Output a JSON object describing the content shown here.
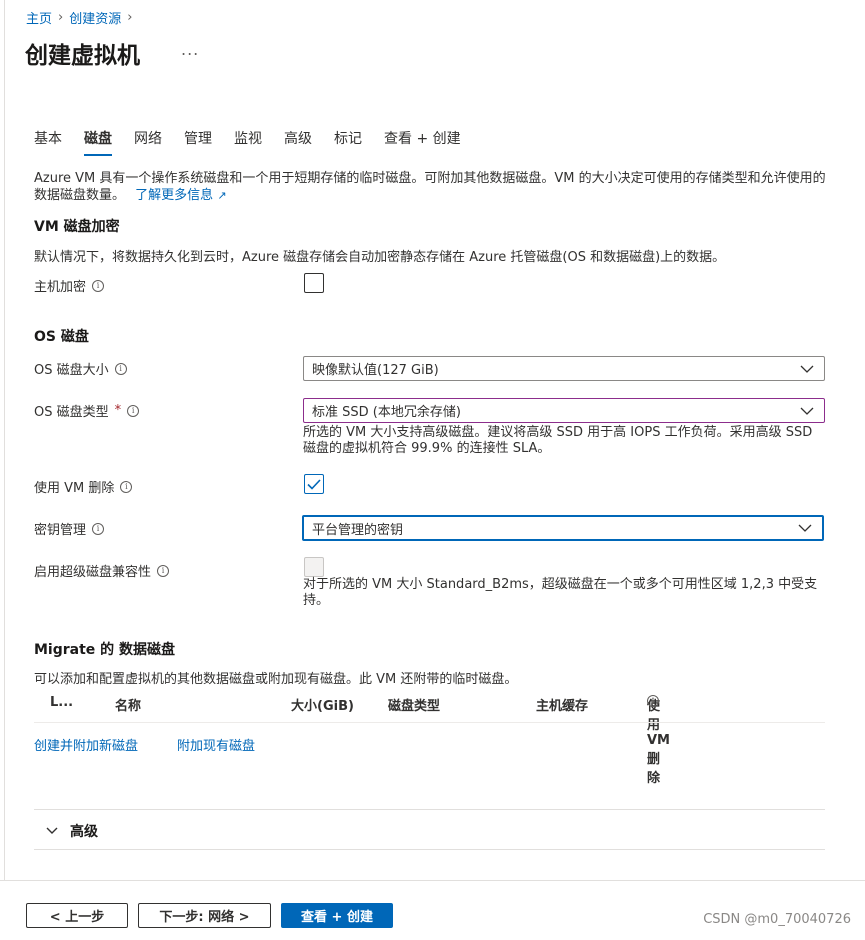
{
  "breadcrumb": {
    "home": "主页",
    "create_resource": "创建资源"
  },
  "page": {
    "title": "创建虚拟机",
    "more": "..."
  },
  "tabs": [
    {
      "label": "基本"
    },
    {
      "label": "磁盘",
      "active": true
    },
    {
      "label": "网络"
    },
    {
      "label": "管理"
    },
    {
      "label": "监视"
    },
    {
      "label": "高级"
    },
    {
      "label": "标记"
    },
    {
      "label": "查看 + 创建"
    }
  ],
  "intro": {
    "text": "Azure VM 具有一个操作系统磁盘和一个用于短期存储的临时磁盘。可附加其他数据磁盘。VM 的大小决定可使用的存储类型和允许使用的数据磁盘数量。",
    "learn_more": "了解更多信息"
  },
  "encryption": {
    "heading": "VM 磁盘加密",
    "description": "默认情况下，将数据持久化到云时，Azure 磁盘存储会自动加密静态存储在 Azure 托管磁盘(OS 和数据磁盘)上的数据。",
    "host_encryption_label": "主机加密",
    "host_encryption_checked": false
  },
  "os_disk": {
    "heading": "OS 磁盘",
    "size_label": "OS 磁盘大小",
    "size_value": "映像默认值(127 GiB)",
    "type_label": "OS 磁盘类型",
    "type_required": "*",
    "type_value": "标准 SSD (本地冗余存储)",
    "type_helper": "所选的 VM 大小支持高级磁盘。建议将高级 SSD 用于高 IOPS 工作负荷。采用高级 SSD 磁盘的虚拟机符合 99.9% 的连接性 SLA。",
    "delete_with_vm_label": "使用 VM 删除",
    "delete_with_vm_checked": true,
    "key_mgmt_label": "密钥管理",
    "key_mgmt_value": "平台管理的密钥",
    "ultra_label": "启用超级磁盘兼容性",
    "ultra_checked": false,
    "ultra_helper": "对于所选的 VM 大小 Standard_B2ms，超级磁盘在一个或多个可用性区域 1,2,3 中受支持。"
  },
  "data_disks": {
    "heading": "Migrate 的 数据磁盘",
    "description": "可以添加和配置虚拟机的其他数据磁盘或附加现有磁盘。此 VM 还附带的临时磁盘。",
    "columns": [
      "L...",
      "名称",
      "大小(GiB)",
      "磁盘类型",
      "主机缓存",
      "使用 VM 删除"
    ],
    "create_attach_link": "创建并附加新磁盘",
    "attach_existing_link": "附加现有磁盘"
  },
  "advanced": {
    "label": "高级"
  },
  "footer": {
    "prev_button": "< 上一步",
    "next_button": "下一步: 网络 >",
    "review_button": "查看 + 创建"
  },
  "watermark": "CSDN @m0_70040726",
  "colors": {
    "accent": "#0067b8",
    "error_border": "#8c2d8c",
    "required": "#a4262c"
  }
}
